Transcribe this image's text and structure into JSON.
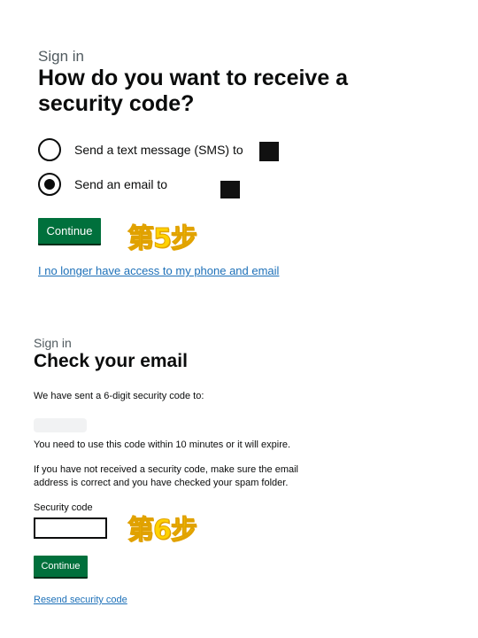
{
  "step5": {
    "caption": "Sign in",
    "heading": "How do you want to receive a security code?",
    "options": [
      {
        "label": "Send a text message (SMS) to",
        "checked": false
      },
      {
        "label": "Send an email to",
        "checked": true
      }
    ],
    "continue_label": "Continue",
    "badge": "第5步",
    "no_access_link": "I no longer have access to my phone and email"
  },
  "step6": {
    "caption": "Sign in",
    "heading": "Check your email",
    "sent_text": "We have sent a 6-digit security code to:",
    "expire_text": "You need to use this code within 10 minutes or it will expire.",
    "spam_text": "If you have not received a security code, make sure the email address is correct and you have checked your spam folder.",
    "code_label": "Security code",
    "code_value": "",
    "badge": "第6步",
    "continue_label": "Continue",
    "resend_link": "Resend security code"
  },
  "colors": {
    "button_green": "#00703c",
    "link_blue": "#1d70b8",
    "text": "#0b0c0c",
    "secondary_text": "#505a5f",
    "badge_yellow": "#ffd200"
  }
}
